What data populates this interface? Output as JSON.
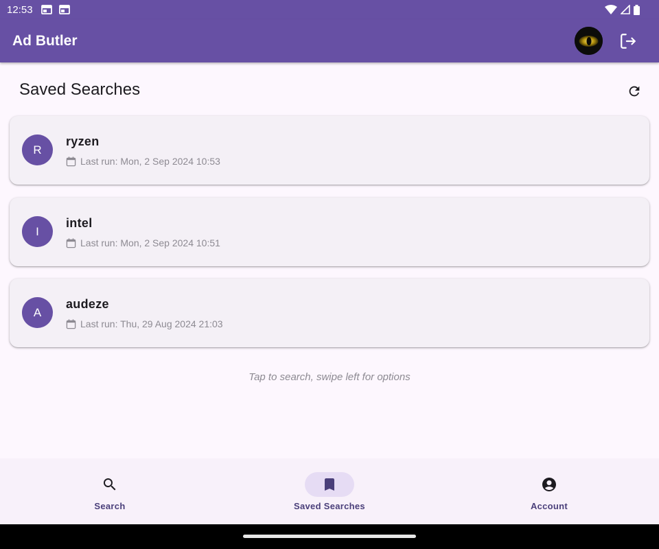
{
  "status_bar": {
    "time": "12:53"
  },
  "app_bar": {
    "title": "Ad Butler"
  },
  "saved": {
    "title": "Saved Searches",
    "items": [
      {
        "initial": "R",
        "name": "ryzen",
        "last_run": "Last run: Mon, 2 Sep 2024 10:53"
      },
      {
        "initial": "I",
        "name": "intel",
        "last_run": "Last run: Mon, 2 Sep 2024 10:51"
      },
      {
        "initial": "A",
        "name": "audeze",
        "last_run": "Last run: Thu, 29 Aug 2024 21:03"
      }
    ],
    "hint": "Tap to search, swipe left for options"
  },
  "nav": {
    "items": [
      {
        "label": "Search",
        "icon": "search-icon",
        "active": false
      },
      {
        "label": "Saved Searches",
        "icon": "bookmark-icon",
        "active": true
      },
      {
        "label": "Account",
        "icon": "account-circle-icon",
        "active": false
      }
    ]
  },
  "colors": {
    "primary": "#6750a4",
    "background": "#fdf7fe",
    "card": "#f4f0f6",
    "nav_active_pill": "#e6dcf4"
  }
}
